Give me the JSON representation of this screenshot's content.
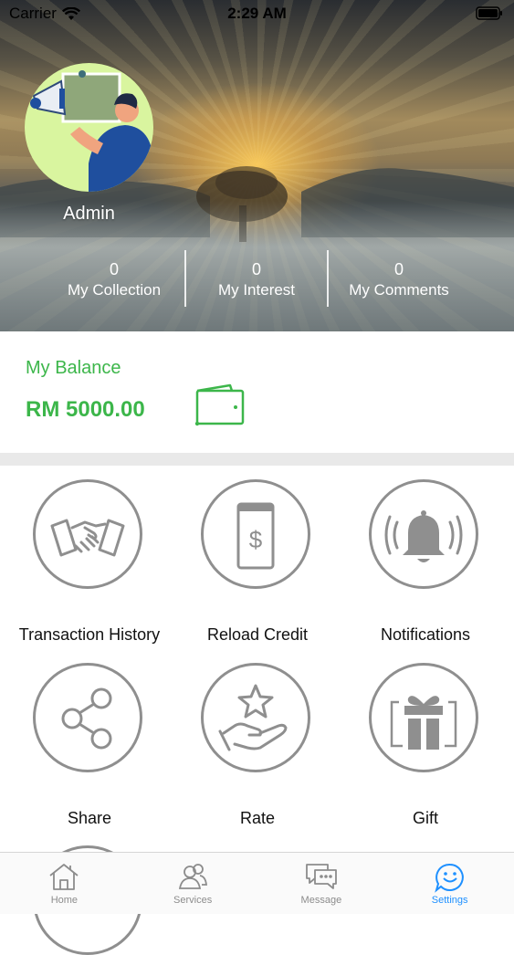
{
  "status_bar": {
    "carrier": "Carrier",
    "time": "2:29 AM"
  },
  "profile": {
    "name": "Admin"
  },
  "stats": [
    {
      "count": "0",
      "label": "My Collection"
    },
    {
      "count": "0",
      "label": "My Interest"
    },
    {
      "count": "0",
      "label": "My Comments"
    }
  ],
  "balance": {
    "title": "My Balance",
    "amount": "RM 5000.00",
    "icon": "wallet-icon"
  },
  "menu": [
    {
      "label": "Transaction History",
      "icon": "handshake-icon"
    },
    {
      "label": "Reload Credit",
      "icon": "dollar-phone-icon"
    },
    {
      "label": "Notifications",
      "icon": "bell-icon"
    },
    {
      "label": "Share",
      "icon": "share-icon"
    },
    {
      "label": "Rate",
      "icon": "star-hand-icon"
    },
    {
      "label": "Gift",
      "icon": "gift-icon"
    }
  ],
  "tabs": [
    {
      "label": "Home",
      "icon": "home-icon"
    },
    {
      "label": "Services",
      "icon": "users-icon"
    },
    {
      "label": "Message",
      "icon": "message-icon"
    },
    {
      "label": "Settings",
      "icon": "smile-icon",
      "active": true
    }
  ],
  "colors": {
    "accent": "#3cb64a",
    "tab_active": "#1e90ff",
    "icon_gray": "#8f8f8f"
  }
}
